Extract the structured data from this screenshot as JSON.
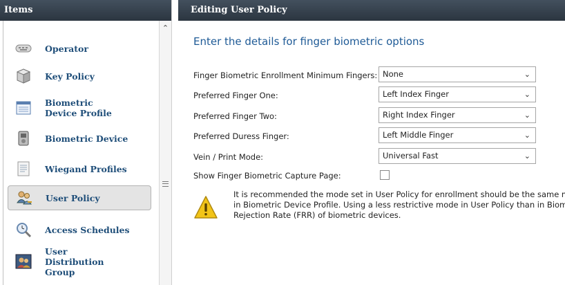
{
  "left_panel": {
    "title": "Items",
    "items": [
      {
        "label": "Operator",
        "icon": "keyboard-icon"
      },
      {
        "label": "Key Policy",
        "icon": "cube-icon"
      },
      {
        "label": "Biometric Device Profile",
        "icon": "profile-window-icon"
      },
      {
        "label": "Biometric Device",
        "icon": "biometric-reader-icon"
      },
      {
        "label": "Wiegand Profiles",
        "icon": "document-icon"
      },
      {
        "label": "User Policy",
        "icon": "users-key-icon",
        "selected": true
      },
      {
        "label": "Access Schedules",
        "icon": "magnifier-clock-icon"
      },
      {
        "label": "User Distribution Group",
        "icon": "group-photo-icon"
      }
    ]
  },
  "right_panel": {
    "title": "Editing User Policy",
    "form_title": "Enter the details for finger biometric options",
    "fields": [
      {
        "label": "Finger Biometric Enrollment Minimum Fingers:",
        "value": "None"
      },
      {
        "label": "Preferred Finger One:",
        "value": "Left Index Finger"
      },
      {
        "label": "Preferred Finger Two:",
        "value": "Right Index Finger"
      },
      {
        "label": "Preferred Duress Finger:",
        "value": "Left Middle Finger"
      },
      {
        "label": "Vein / Print Mode:",
        "value": "Universal Fast"
      }
    ],
    "checkbox": {
      "label": "Show Finger Biometric Capture Page:",
      "checked": false
    },
    "warning": {
      "line1": "It is recommended the mode set in User Policy for enrollment should be the same mode o",
      "line2": "in Biometric Device Profile.  Using a less restrictive mode in User Policy than in Biometric D",
      "line3": "Rejection Rate (FRR) of biometric devices."
    }
  },
  "colors": {
    "header_bg": "#37424e",
    "label_blue": "#1f4e79",
    "title_blue": "#1e5a96",
    "warning_yellow": "#f2c418"
  }
}
